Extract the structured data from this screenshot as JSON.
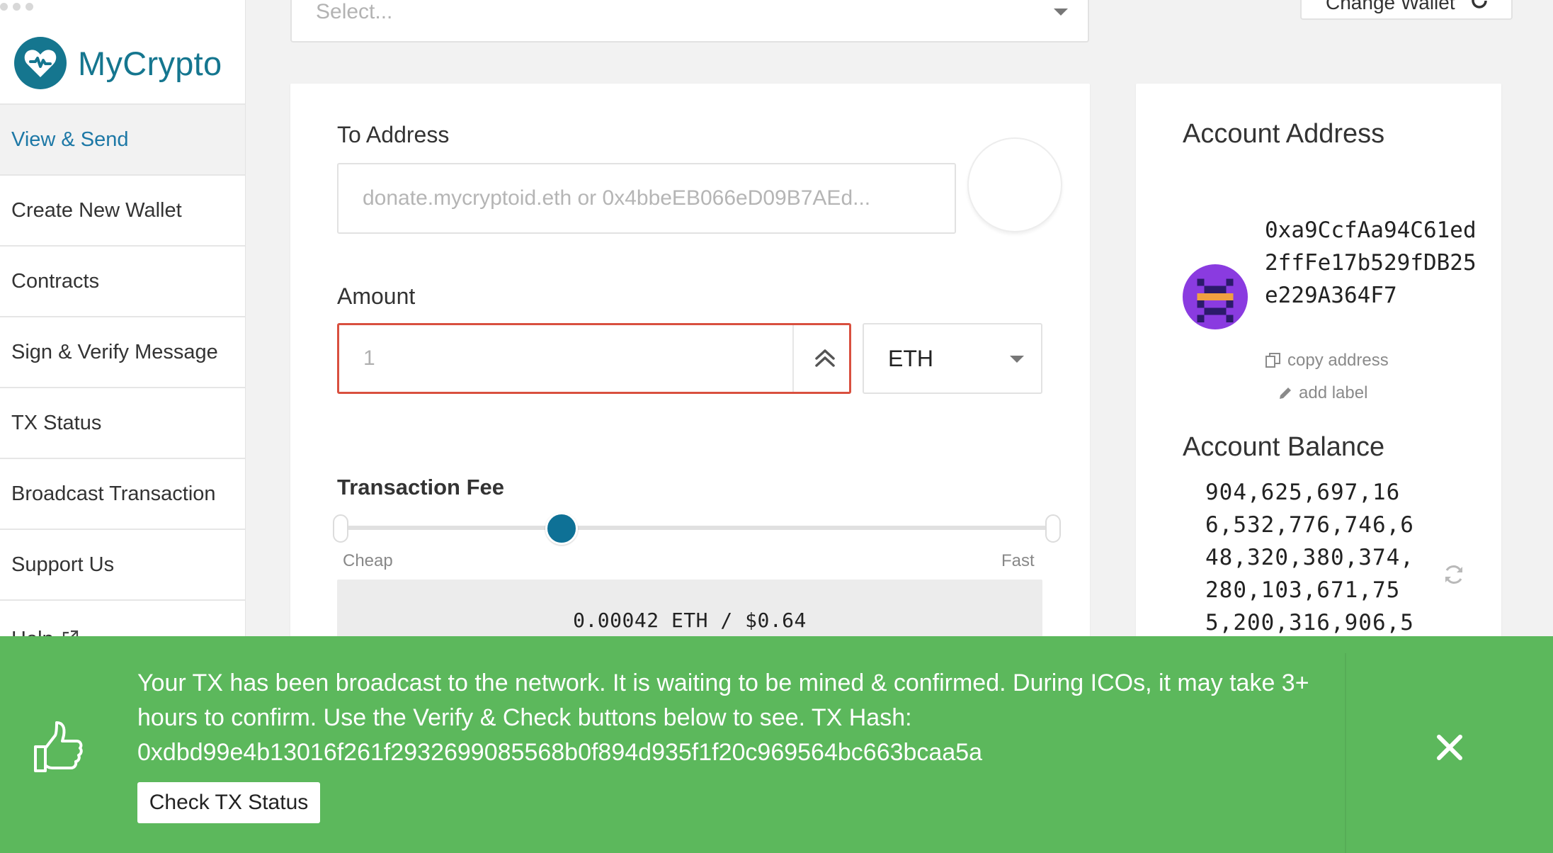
{
  "sidebar": {
    "brand": "MyCrypto",
    "items": [
      {
        "label": "View & Send",
        "active": true
      },
      {
        "label": "Create New Wallet"
      },
      {
        "label": "Contracts"
      },
      {
        "label": "Sign & Verify Message"
      },
      {
        "label": "TX Status"
      },
      {
        "label": "Broadcast Transaction"
      },
      {
        "label": "Support Us"
      },
      {
        "label": "Help",
        "icon": "external-link-icon"
      }
    ]
  },
  "top": {
    "select_placeholder": "Select...",
    "change_wallet_label": "Change Wallet"
  },
  "send": {
    "to_label": "To Address",
    "to_placeholder": "donate.mycryptoid.eth or 0x4bbeEB066eD09B7AEd...",
    "amount_label": "Amount",
    "amount_placeholder": "1",
    "unit": "ETH",
    "fee_label": "Transaction Fee",
    "fee_slider_level": 0.31,
    "fee_min_label": "Cheap",
    "fee_max_label": "Fast",
    "fee_display": "0.00042 ETH / $0.64"
  },
  "account": {
    "address_title": "Account Address",
    "address": "0xa9CcfAa94C61ed2ffFe17b529fDB25e229A364F7",
    "copy_label": "copy address",
    "add_label": "add label",
    "balance_title": "Account Balance",
    "balance": "904,625,697,166,532,776,746,648,320,380,374,280,103,671,755,200,316,906,5"
  },
  "notification": {
    "message": "Your TX has been broadcast to the network. It is waiting to be mined & confirmed. During ICOs, it may take 3+ hours to confirm. Use the Verify & Check buttons below to see. TX Hash: 0xdbd99e4b13016f261f2932699085568b0f894d935f1f20c969564bc663bcaa5a",
    "button_label": "Check TX Status"
  },
  "colors": {
    "brand": "#15768f",
    "active_nav": "#1d78a6",
    "slider_thumb": "#0e7196",
    "error_border": "#d9503f",
    "success": "#5cb85c"
  }
}
